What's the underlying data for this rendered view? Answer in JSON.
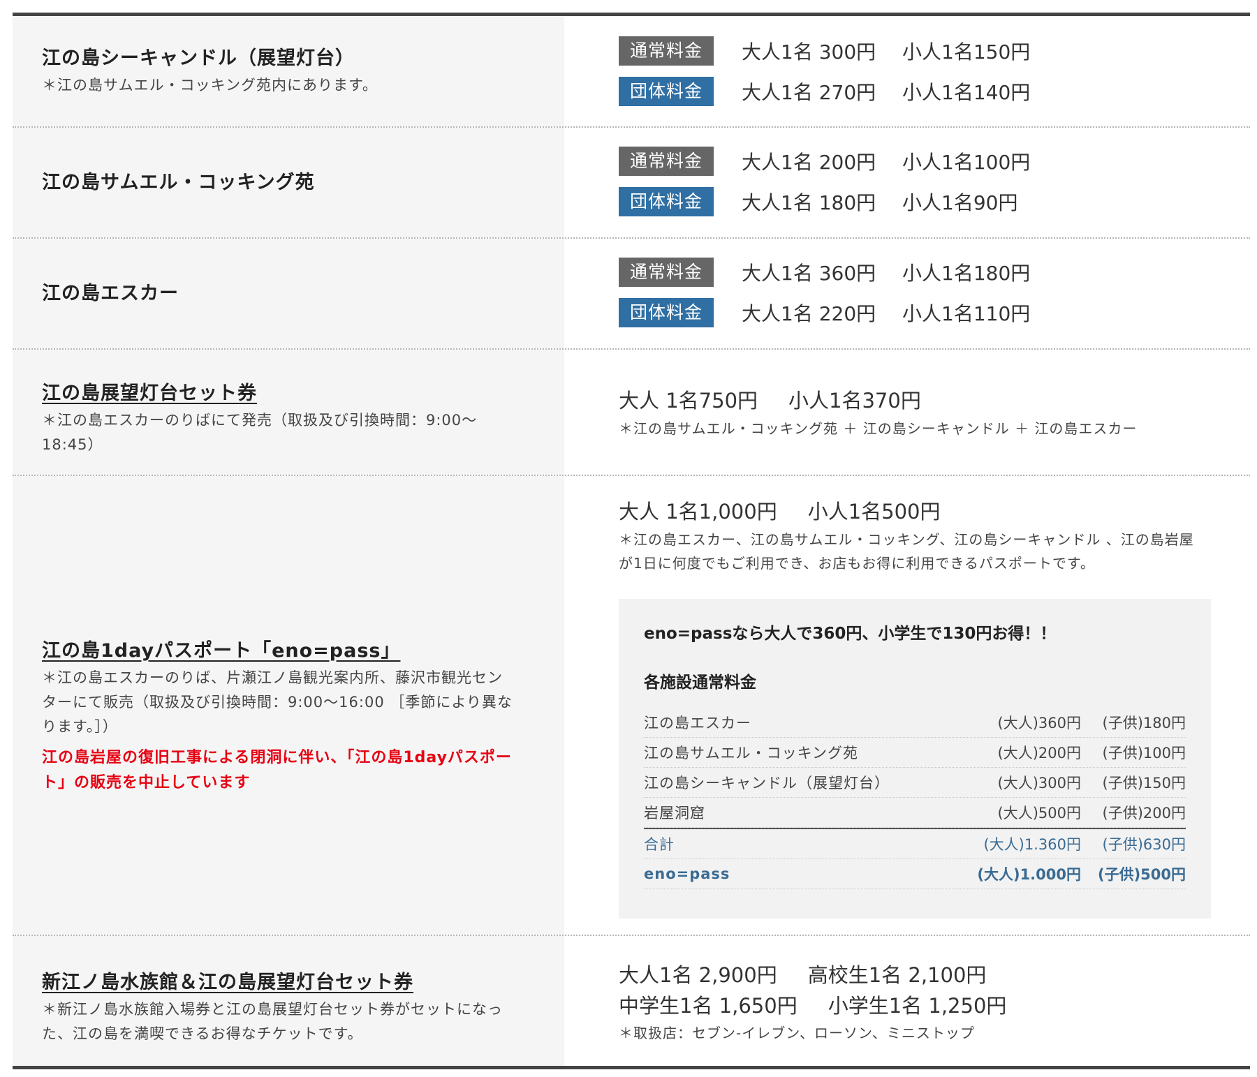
{
  "badges": {
    "normal": "通常料金",
    "group": "団体料金"
  },
  "rows": [
    {
      "title": "江の島シーキャンドル（展望灯台）",
      "note": "＊江の島サムエル・コッキング苑内にあります。",
      "normal": {
        "adult": "大人1名 300円",
        "child": "小人1名150円"
      },
      "group": {
        "adult": "大人1名 270円",
        "child": "小人1名140円"
      }
    },
    {
      "title": "江の島サムエル・コッキング苑",
      "normal": {
        "adult": "大人1名 200円",
        "child": "小人1名100円"
      },
      "group": {
        "adult": "大人1名 180円",
        "child": "小人1名90円"
      }
    },
    {
      "title": "江の島エスカー",
      "normal": {
        "adult": "大人1名 360円",
        "child": "小人1名180円"
      },
      "group": {
        "adult": "大人1名 220円",
        "child": "小人1名110円"
      }
    },
    {
      "title": "江の島展望灯台セット券",
      "note1": "＊江の島エスカーのりばにて発売（取扱及び引換時間：9:00～",
      "note2": "18:45）",
      "adult": "大人 1名750円",
      "child": "小人1名370円",
      "pnote": "＊江の島サムエル・コッキング苑 ＋ 江の島シーキャンドル ＋ 江の島エスカー"
    },
    {
      "title": "江の島1dayパスポート「eno=pass」",
      "note1": "＊江の島エスカーのりば、片瀬江ノ島観光案内所、藤沢市観光セン",
      "note2": "ターにて販売（取扱及び引換時間：9:00～16:00 ［季節により異な",
      "note3": "ります。］）",
      "red1": "江の島岩屋の復旧工事による閉洞に伴い、「江の島1dayパスポー",
      "red2": "ト」の販売を中止しています",
      "adult": "大人 1名1,000円",
      "child": "小人1名500円",
      "pnote1": "＊江の島エスカー、江の島サムエル・コッキング、江の島シーキャンドル 、江の島岩屋",
      "pnote2": "が1日に何度でもご利用でき、お店もお得に利用できるパスポートです。",
      "box": {
        "headline": "eno=passなら大人で360円、小学生で130円お得！！",
        "subhead": "各施設通常料金",
        "facilities": [
          {
            "name": "江の島エスカー",
            "adult": "(大人)360円",
            "child": "(子供)180円"
          },
          {
            "name": "江の島サムエル・コッキング苑",
            "adult": "(大人)200円",
            "child": "(子供)100円"
          },
          {
            "name": "江の島シーキャンドル（展望灯台）",
            "adult": "(大人)300円",
            "child": "(子供)150円"
          },
          {
            "name": "岩屋洞窟",
            "adult": "(大人)500円",
            "child": "(子供)200円"
          }
        ],
        "total": {
          "name": "合計",
          "adult": "(大人)1.360円",
          "child": "(子供)630円"
        },
        "pass": {
          "name": "eno=pass",
          "adult": "(大人)1.000円",
          "child": "(子供)500円"
        }
      }
    },
    {
      "title": "新江ノ島水族館＆江の島展望灯台セット券",
      "note1": "＊新江ノ島水族館入場券と江の島展望灯台セット券がセットになっ",
      "note2": "た、江の島を満喫できるお得なチケットです。",
      "line1a": "大人1名 2,900円",
      "line1b": "高校生1名 2,100円",
      "line2a": "中学生1名 1,650円",
      "line2b": "小学生1名 1,250円",
      "pnote": "＊取扱店：セブン-イレブン、ローソン、ミニストップ"
    }
  ]
}
